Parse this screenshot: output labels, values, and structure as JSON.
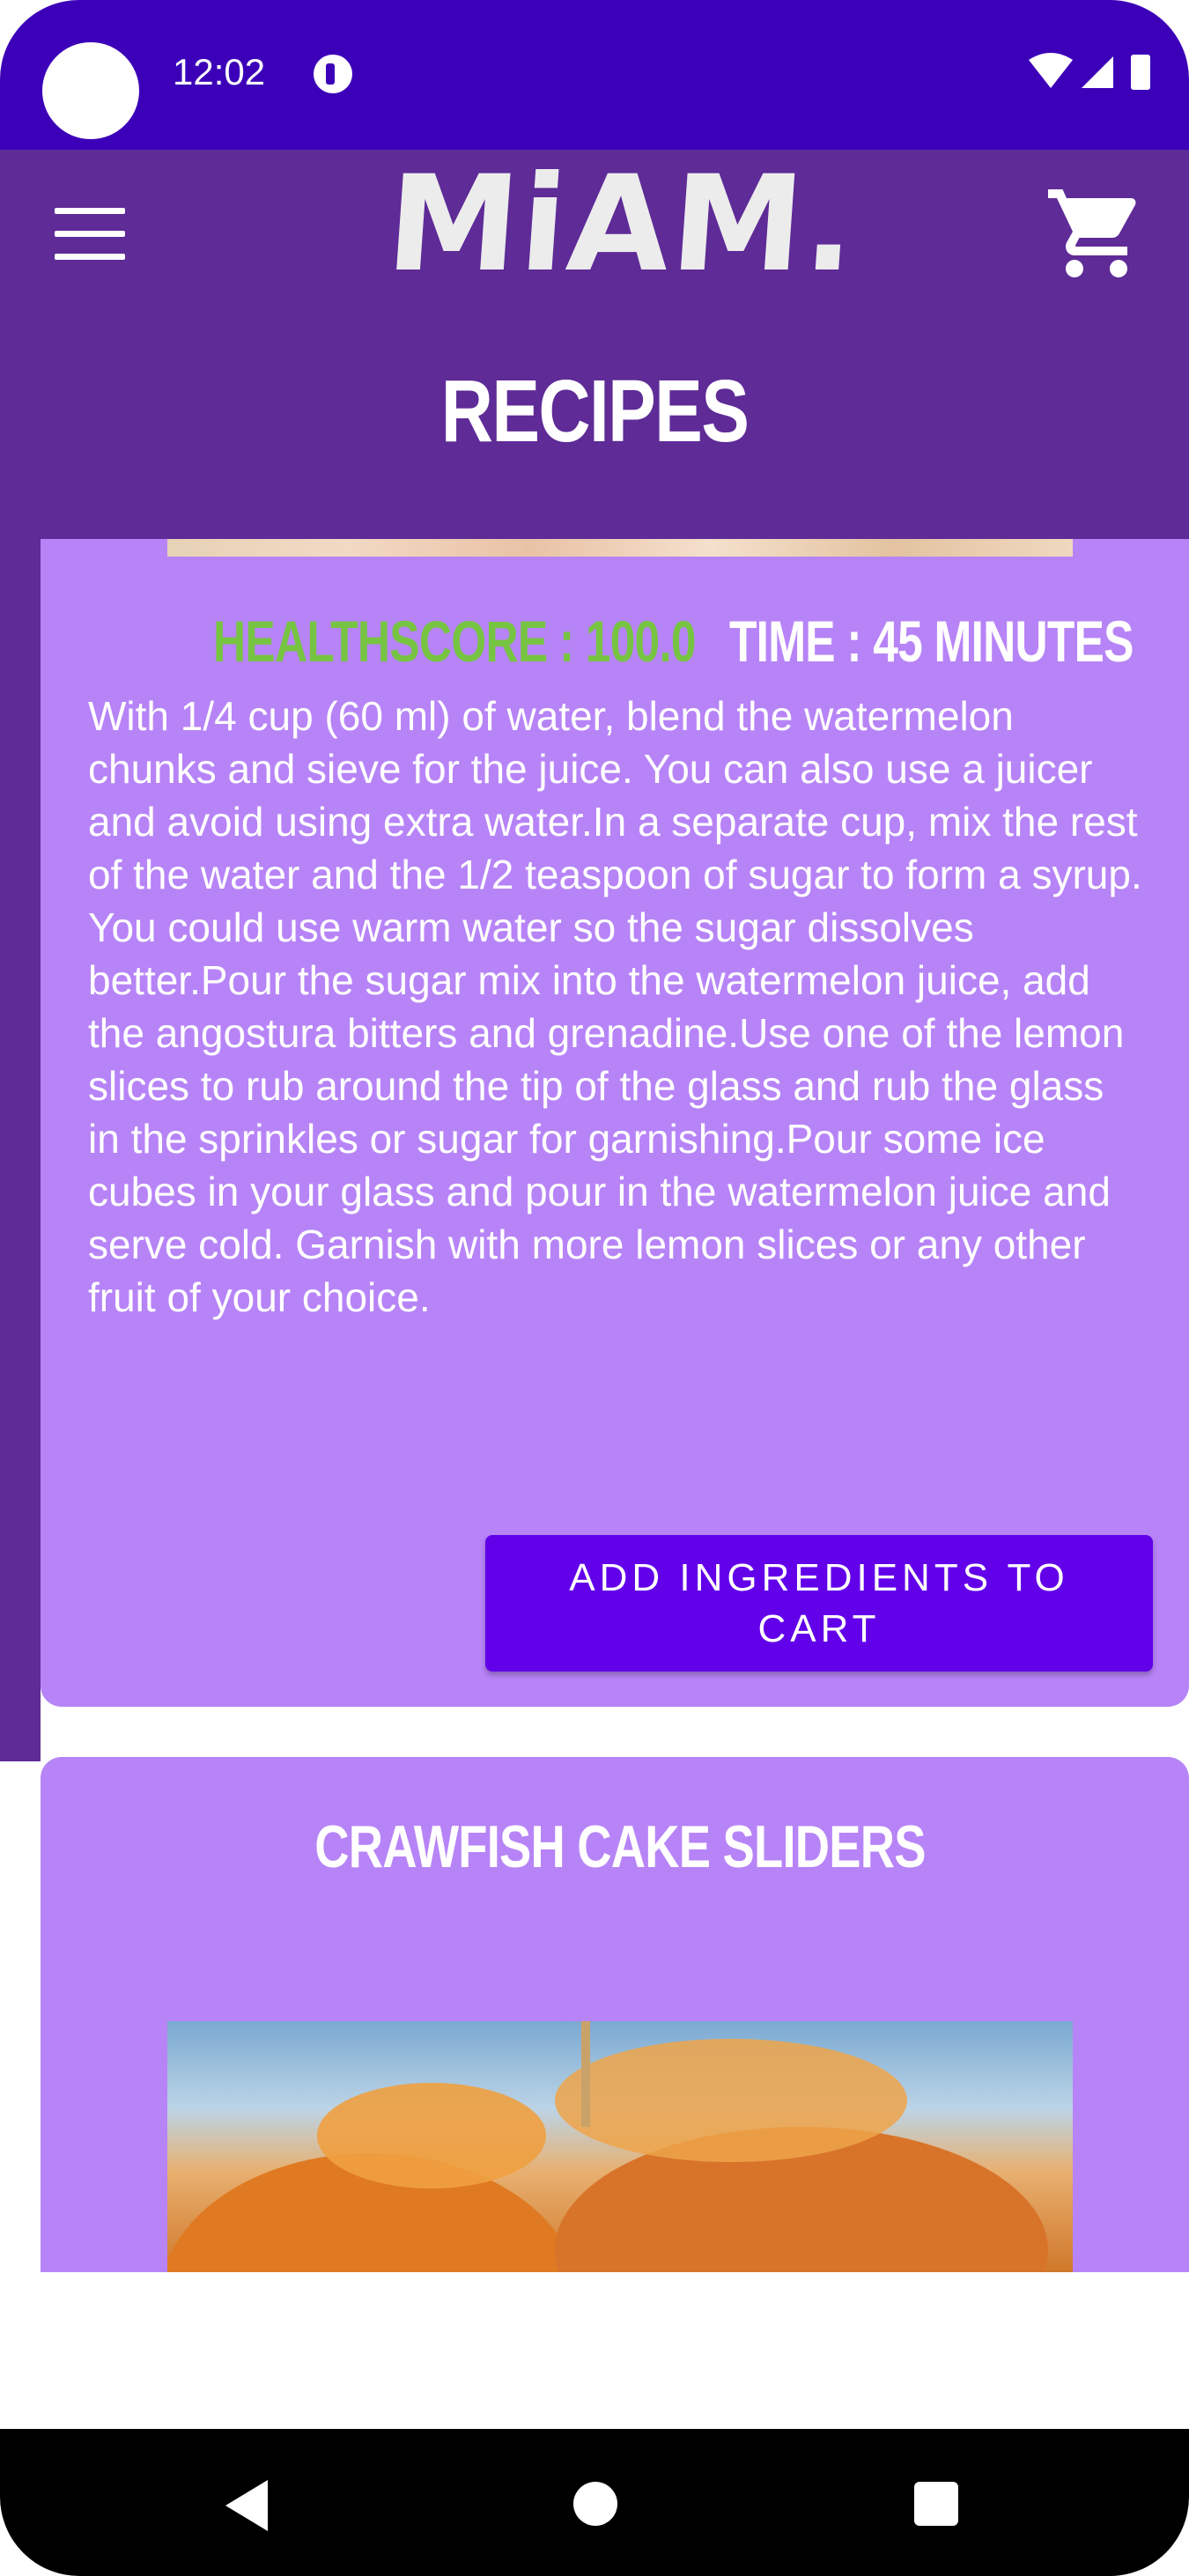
{
  "status_bar": {
    "time": "12:02",
    "icons": [
      "notification-icon",
      "wifi-icon",
      "signal-icon",
      "battery-icon"
    ]
  },
  "header": {
    "logo_text": "MiAM.",
    "title": "RECIPES",
    "menu_icon": "hamburger-menu-icon",
    "cart_icon": "shopping-cart-icon"
  },
  "recipe_card": {
    "healthscore": "HEALTHSCORE : 100.0",
    "time": "TIME : 45 MINUTES",
    "instructions": "With 1/4 cup (60 ml) of water, blend the watermelon chunks and sieve for the juice. You can also use a juicer and avoid using extra water.In a separate cup, mix the rest of the water and the 1/2 teaspoon of sugar to form a syrup. You could use warm water so the sugar dissolves better.Pour the sugar mix into the watermelon juice, add the angostura bitters and grenadine.Use one of the lemon slices to rub around the tip of the glass and rub the glass in the sprinkles or sugar for garnishing.Pour some ice cubes in your glass and pour in the watermelon juice and serve cold. Garnish with more lemon slices or any other fruit of your choice.",
    "add_button_label": "ADD  INGREDIENTS TO CART"
  },
  "next_card": {
    "title": "CRAWFISH CAKE SLIDERS"
  },
  "colors": {
    "status_bar": "#3c00b8",
    "header": "#5e2b97",
    "card": "#b784f7",
    "button": "#6200ea",
    "healthscore": "#76c442"
  },
  "nav": {
    "icons": [
      "back-icon",
      "home-icon",
      "recents-icon"
    ]
  }
}
